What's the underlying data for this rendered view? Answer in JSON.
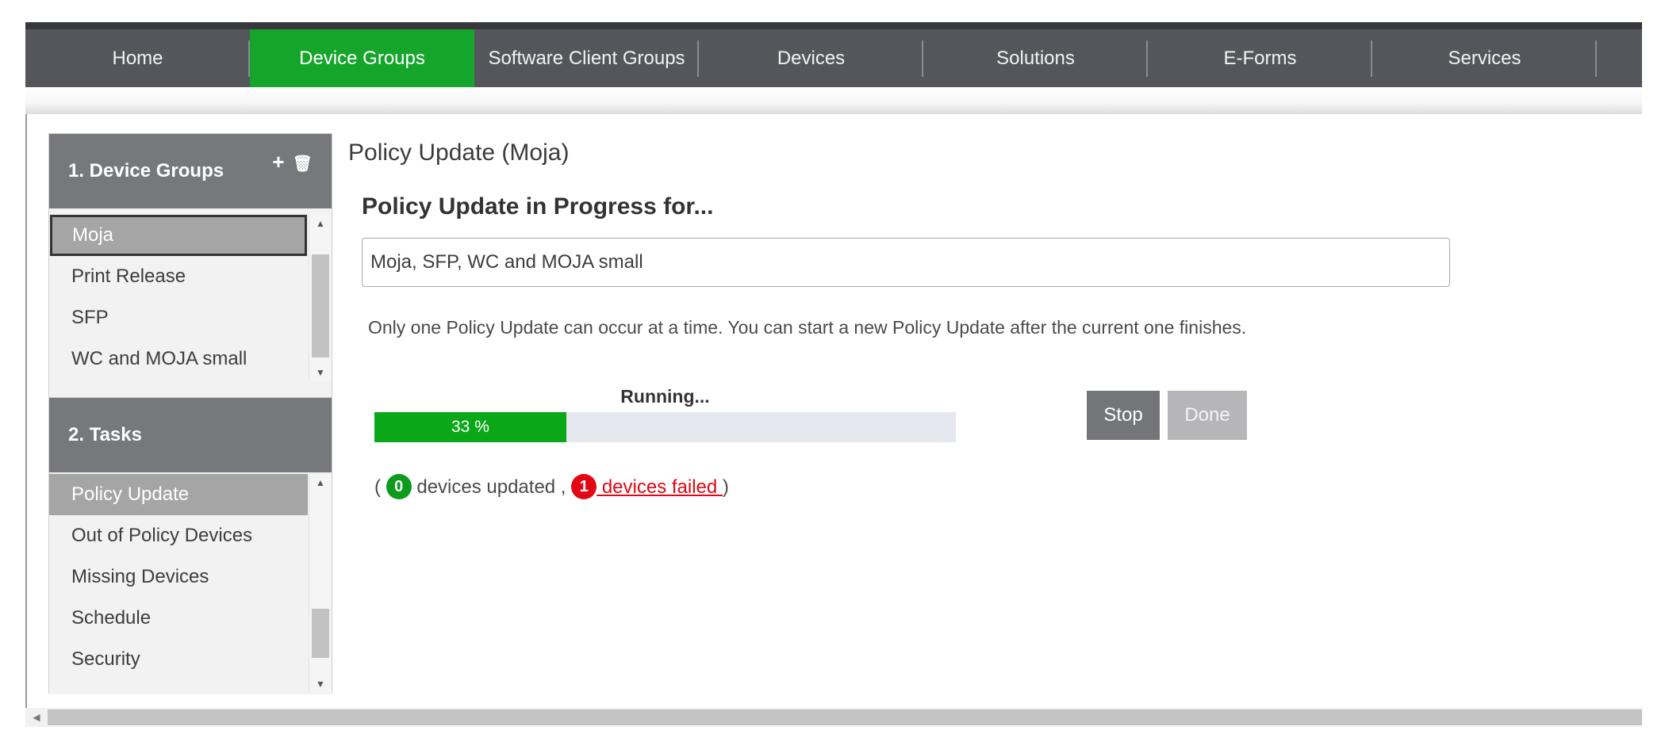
{
  "topnav": {
    "items": [
      {
        "label": "Home",
        "active": false
      },
      {
        "label": "Device Groups",
        "active": true
      },
      {
        "label": "Software Client Groups",
        "active": false
      },
      {
        "label": "Devices",
        "active": false
      },
      {
        "label": "Solutions",
        "active": false
      },
      {
        "label": "E-Forms",
        "active": false
      },
      {
        "label": "Services",
        "active": false
      }
    ]
  },
  "sidebar": {
    "device_groups": {
      "title": "1. Device Groups",
      "add_icon": "+",
      "delete_icon": "🗑",
      "items": [
        "Moja",
        "Print Release",
        "SFP",
        "WC and MOJA small"
      ],
      "selected": "Moja"
    },
    "tasks": {
      "title": "2. Tasks",
      "items": [
        "Policy Update",
        "Out of Policy Devices",
        "Missing Devices",
        "Schedule",
        "Security"
      ],
      "selected": "Policy Update"
    }
  },
  "main": {
    "page_title": "Policy Update (Moja)",
    "section_title": "Policy Update in Progress for...",
    "groups_value": "Moja, SFP, WC and MOJA small",
    "info_text": "Only one Policy Update can occur at a time. You can start a new Policy Update after the current one finishes.",
    "status_label": "Running...",
    "progress_percent": 33,
    "progress_text": "33 %",
    "stop_label": "Stop",
    "done_label": "Done",
    "status": {
      "open_paren": "(",
      "updated_count": "0",
      "updated_text": "devices updated ,",
      "failed_count": "1",
      "failed_text": " devices failed ",
      "close_paren": ")"
    }
  },
  "colors": {
    "nav_bg": "#55565b",
    "nav_active": "#15a52b",
    "progress_fill": "#0aa718",
    "badge_green": "#0c9b1c",
    "badge_red": "#e30613"
  }
}
